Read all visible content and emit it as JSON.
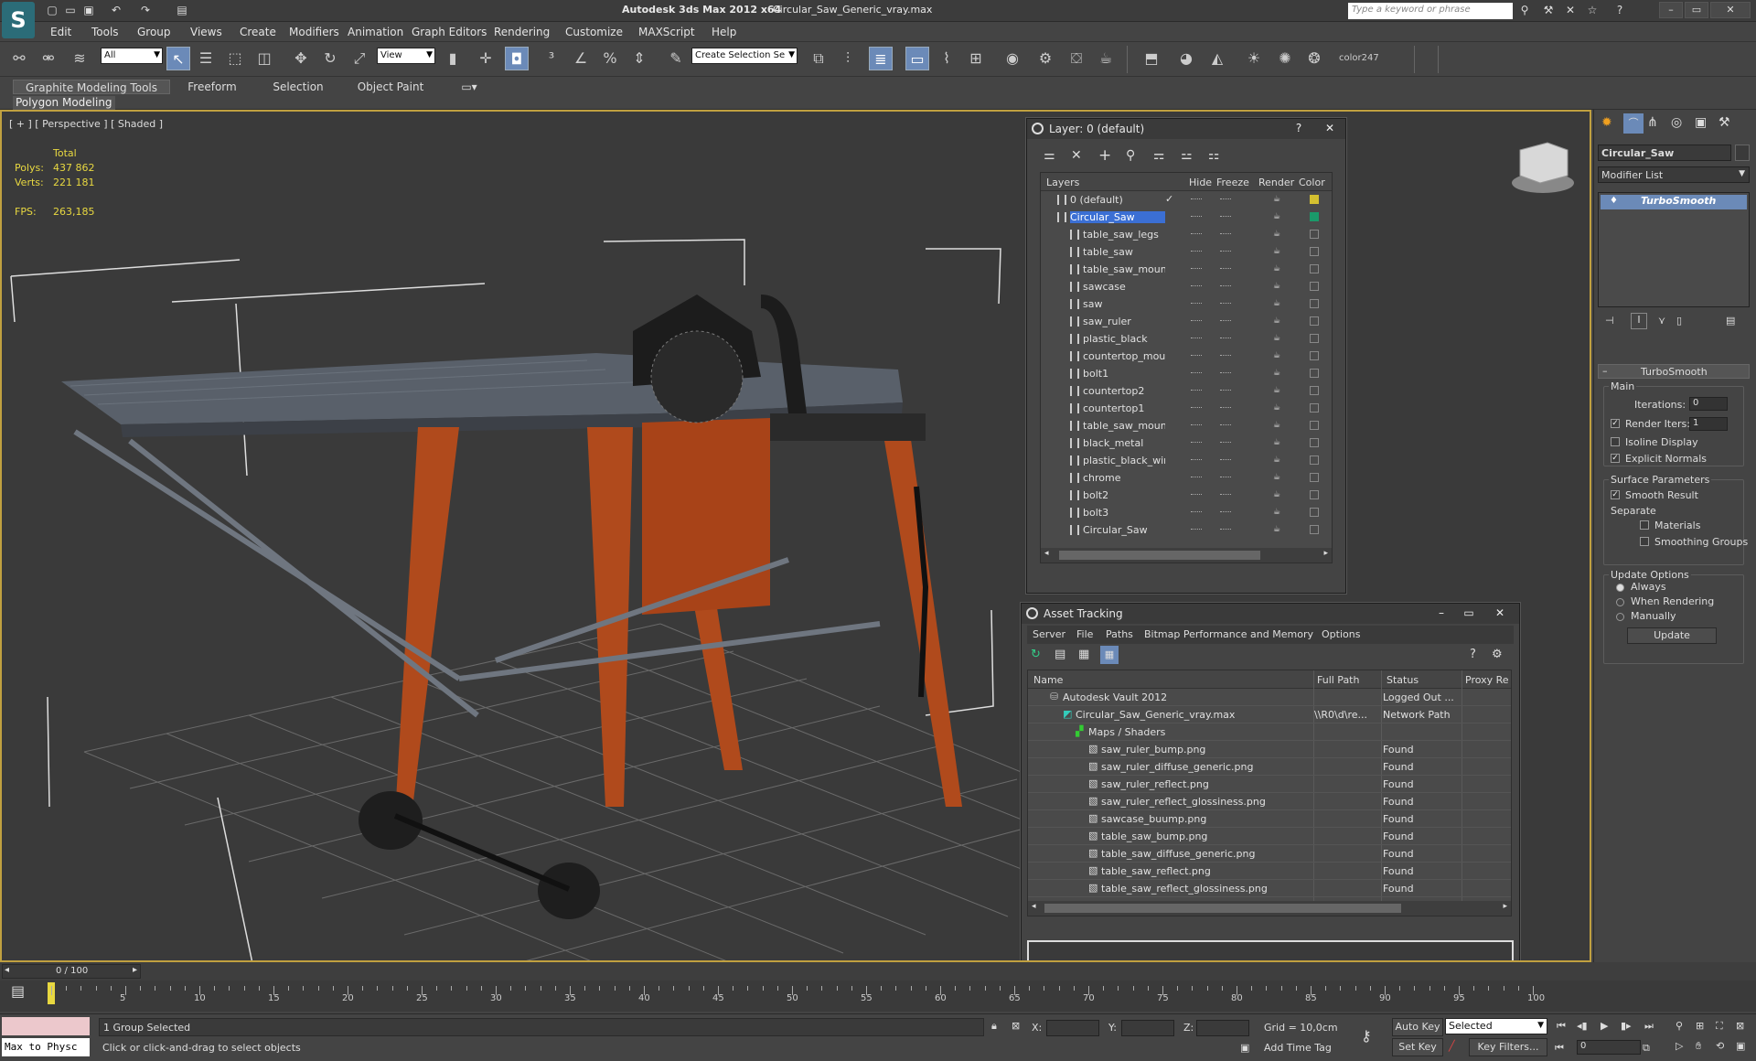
{
  "window": {
    "app_title": "Autodesk 3ds Max  2012 x64",
    "file_title": "Circular_Saw_Generic_vray.max",
    "search_placeholder": "Type a keyword or phrase"
  },
  "menu": [
    "Edit",
    "Tools",
    "Group",
    "Views",
    "Create",
    "Modifiers",
    "Animation",
    "Graph Editors",
    "Rendering",
    "Customize",
    "MAXScript",
    "Help"
  ],
  "toolbar": {
    "filter_value": "All",
    "refcoord_value": "View",
    "selection_set_value": "Create Selection Se",
    "color_label": "color247"
  },
  "ribbon": {
    "tabs": [
      "Graphite Modeling Tools",
      "Freeform",
      "Selection",
      "Object Paint"
    ],
    "sub_label": "Polygon Modeling"
  },
  "viewport": {
    "label": "[ + ] [ Perspective ] [ Shaded ]",
    "stats": {
      "total_label": "Total",
      "polys_label": "Polys:",
      "polys_value": "437 862",
      "verts_label": "Verts:",
      "verts_value": "221 181",
      "fps_label": "FPS:",
      "fps_value": "263,185"
    }
  },
  "layer_panel": {
    "title": "Layer: 0 (default)",
    "columns": {
      "layers": "Layers",
      "hide": "Hide",
      "freeze": "Freeze",
      "render": "Render",
      "color": "Color"
    },
    "rows": [
      {
        "name": "0 (default)",
        "level": 1,
        "check": "✓",
        "color": "#d4c030"
      },
      {
        "name": "Circular_Saw",
        "level": 1,
        "selected": true,
        "color": "#1a9a6a"
      },
      {
        "name": "table_saw_legs",
        "level": 2
      },
      {
        "name": "table_saw",
        "level": 2
      },
      {
        "name": "table_saw_moun",
        "level": 2
      },
      {
        "name": "sawcase",
        "level": 2
      },
      {
        "name": "saw",
        "level": 2
      },
      {
        "name": "saw_ruler",
        "level": 2
      },
      {
        "name": "plastic_black",
        "level": 2
      },
      {
        "name": "countertop_mou",
        "level": 2
      },
      {
        "name": "bolt1",
        "level": 2
      },
      {
        "name": "countertop2",
        "level": 2
      },
      {
        "name": "countertop1",
        "level": 2
      },
      {
        "name": "table_saw_moun",
        "level": 2
      },
      {
        "name": "black_metal",
        "level": 2
      },
      {
        "name": "plastic_black_wir",
        "level": 2
      },
      {
        "name": "chrome",
        "level": 2
      },
      {
        "name": "bolt2",
        "level": 2
      },
      {
        "name": "bolt3",
        "level": 2
      },
      {
        "name": "Circular_Saw",
        "level": 2
      }
    ]
  },
  "asset_panel": {
    "title": "Asset Tracking",
    "menu": [
      "Server",
      "File",
      "Paths",
      "Bitmap Performance and Memory",
      "Options"
    ],
    "columns": {
      "name": "Name",
      "full_path": "Full Path",
      "status": "Status",
      "proxy": "Proxy Re"
    },
    "rows": [
      {
        "name": "Autodesk Vault 2012",
        "indent": 1,
        "path": "",
        "status": "Logged Out ..."
      },
      {
        "name": "Circular_Saw_Generic_vray.max",
        "indent": 2,
        "path": "\\\\R0\\d\\re...",
        "status": "Network Path"
      },
      {
        "name": "Maps / Shaders",
        "indent": 3,
        "path": "",
        "status": ""
      },
      {
        "name": "saw_ruler_bump.png",
        "indent": 4,
        "path": "",
        "status": "Found"
      },
      {
        "name": "saw_ruler_diffuse_generic.png",
        "indent": 4,
        "path": "",
        "status": "Found"
      },
      {
        "name": "saw_ruler_reflect.png",
        "indent": 4,
        "path": "",
        "status": "Found"
      },
      {
        "name": "saw_ruler_reflect_glossiness.png",
        "indent": 4,
        "path": "",
        "status": "Found"
      },
      {
        "name": "sawcase_buump.png",
        "indent": 4,
        "path": "",
        "status": "Found"
      },
      {
        "name": "table_saw_bump.png",
        "indent": 4,
        "path": "",
        "status": "Found"
      },
      {
        "name": "table_saw_diffuse_generic.png",
        "indent": 4,
        "path": "",
        "status": "Found"
      },
      {
        "name": "table_saw_reflect.png",
        "indent": 4,
        "path": "",
        "status": "Found"
      },
      {
        "name": "table_saw_reflect_glossiness.png",
        "indent": 4,
        "path": "",
        "status": "Found"
      }
    ]
  },
  "command_panel": {
    "object_name": "Circular_Saw",
    "modifier_list": "Modifier List",
    "stack_item": "TurboSmooth",
    "rollout_title": "TurboSmooth",
    "main_label": "Main",
    "iterations_label": "Iterations:",
    "iterations_value": "0",
    "render_iters_label": "Render Iters:",
    "render_iters_value": "1",
    "isoline_label": "Isoline Display",
    "explicit_label": "Explicit Normals",
    "surface_label": "Surface Parameters",
    "smooth_label": "Smooth Result",
    "separate_label": "Separate",
    "materials_label": "Materials",
    "smoothing_label": "Smoothing Groups",
    "update_options_label": "Update Options",
    "always_label": "Always",
    "when_rendering_label": "When Rendering",
    "manually_label": "Manually",
    "update_button": "Update"
  },
  "timeline": {
    "frame_label": "0 / 100",
    "ticks": [
      "5",
      "10",
      "15",
      "20",
      "25",
      "30",
      "35",
      "40",
      "45",
      "50",
      "55",
      "60",
      "65",
      "70",
      "75",
      "80",
      "85",
      "90",
      "95",
      "100"
    ]
  },
  "status": {
    "script_label": "Max to Physc",
    "selected_text": "1 Group Selected",
    "prompt_text": "Click or click-and-drag to select objects",
    "x_label": "X:",
    "y_label": "Y:",
    "z_label": "Z:",
    "grid_text": "Grid = 10,0cm",
    "add_time_tag": "Add Time Tag",
    "auto_key": "Auto Key",
    "set_key": "Set Key",
    "selected_combo": "Selected",
    "key_filters": "Key Filters...",
    "frame_value": "0"
  }
}
